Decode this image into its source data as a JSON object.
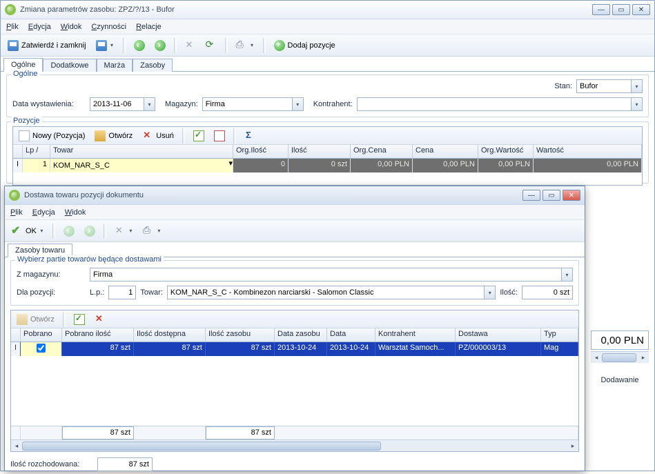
{
  "main": {
    "title": "Zmiana parametrów zasobu: ZPZ/?/13 - Bufor",
    "menu": [
      "Plik",
      "Edycja",
      "Widok",
      "Czynności",
      "Relacje"
    ],
    "toolbar": {
      "confirm_close": "Zatwierdź i zamknij",
      "add_position": "Dodaj pozycje"
    },
    "tabs": [
      "Ogólne",
      "Dodatkowe",
      "Marża",
      "Zasoby"
    ],
    "group_general": {
      "legend": "Ogólne",
      "stan_label": "Stan:",
      "stan_value": "Bufor",
      "date_label": "Data wystawienia:",
      "date_value": "2013-11-06",
      "magazyn_label": "Magazyn:",
      "magazyn_value": "Firma",
      "kontrahent_label": "Kontrahent:",
      "kontrahent_value": ""
    },
    "group_positions": {
      "legend": "Pozycje",
      "btn_new": "Nowy (Pozycja)",
      "btn_open": "Otwórz",
      "btn_del": "Usuń",
      "cols": [
        "Lp /",
        "Towar",
        "Org.Ilość",
        "Ilość",
        "Org.Cena",
        "Cena",
        "Org.Wartość",
        "Wartość"
      ],
      "row": {
        "lp": "1",
        "towar": "KOM_NAR_S_C",
        "org_ilosc": "0",
        "ilosc": "0 szt",
        "org_cena": "0,00 PLN",
        "cena": "0,00 PLN",
        "org_wartosc": "0,00 PLN",
        "wartosc": "0,00 PLN"
      }
    },
    "total": "0,00 PLN",
    "status": "Dodawanie"
  },
  "child": {
    "title": "Dostawa towaru pozycji dokumentu",
    "menu": [
      "Plik",
      "Edycja",
      "Widok"
    ],
    "toolbar": {
      "ok": "OK"
    },
    "tab": "Zasoby towaru",
    "hint": "Wybierz partie towarów będące dostawami",
    "z_magazynu_label": "Z magazynu:",
    "z_magazynu_value": "Firma",
    "dla_pozycji_label": "Dla pozycji:",
    "lp_label": "L.p.:",
    "lp_value": "1",
    "towar_label": "Towar:",
    "towar_value": "KOM_NAR_S_C - Kombinezon narciarski - Salomon Classic",
    "ilosc_label": "Ilość:",
    "ilosc_value": "0 szt",
    "btn_open": "Otwórz",
    "grid": {
      "cols": [
        "Pobrano",
        "Pobrano ilość",
        "Ilość dostępna",
        "Ilość zasobu",
        "Data zasobu",
        "Data",
        "Kontrahent",
        "Dostawa",
        "Typ"
      ],
      "row": {
        "pobrano_chk": true,
        "pobrano_ilosc": "87 szt",
        "dostepna": "87 szt",
        "zasobu": "87 szt",
        "data_zasobu": "2013-10-24",
        "data": "2013-10-24",
        "kontrahent": "Warsztat Samoch...",
        "dostawa": "PZ/000003/13",
        "typ": "Mag"
      },
      "sum": {
        "pobrano_ilosc": "87 szt",
        "zasobu": "87 szt"
      }
    },
    "footer": {
      "label": "Ilość rozchodowana:",
      "value": "87 szt"
    }
  }
}
